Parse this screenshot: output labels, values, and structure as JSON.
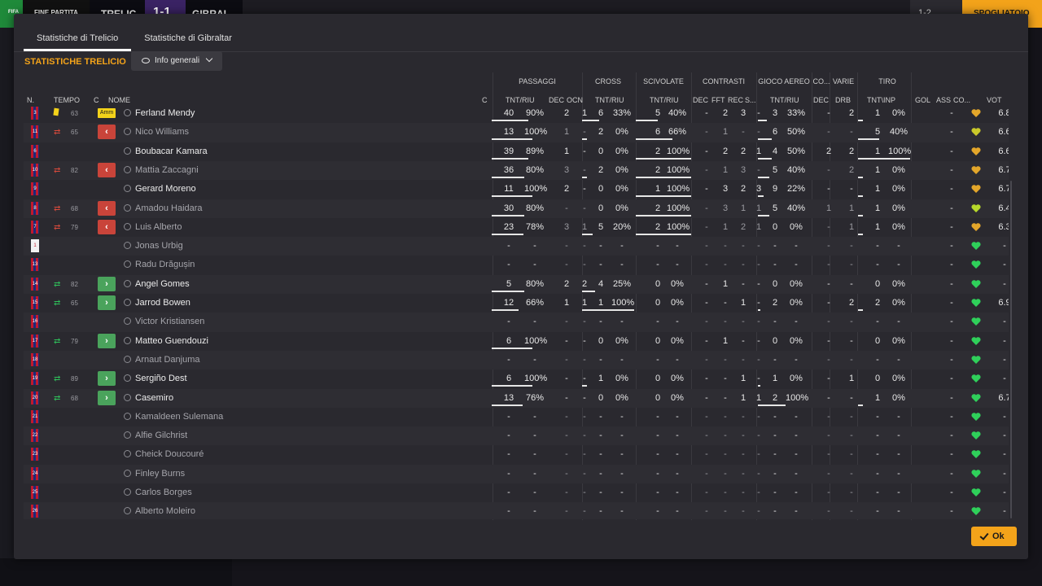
{
  "topbar": {
    "badge": "FIFA",
    "status": "FINE PARTITA",
    "home": "TRELIC",
    "score": "1-1",
    "away": "GIBRAL",
    "btn1": "1-2",
    "btn2": "⌄",
    "orange": "SPOGLIATOIO"
  },
  "tabs": [
    "Statistiche di Trelicio",
    "Statistiche di Gibraltar"
  ],
  "heading": "STATISTICHE TRELICIO",
  "dropdown": "Info generali",
  "group_headers": {
    "passaggi": "PASSAGGI",
    "cross": "CROSS",
    "scivolate": "SCIVOLATE",
    "contrasti": "CONTRASTI",
    "aereo": "GIOCO AEREO",
    "co": "CO...",
    "varie": "VARIE",
    "tiro": "TIRO"
  },
  "columns": {
    "n": "N.",
    "tempo": "TEMPO",
    "c": "C",
    "nome": "NOME",
    "c2": "C",
    "pass_tnt": "TNT/RIU",
    "pass_dec": "DEC",
    "pass_ocn": "OCN",
    "cross_tnt": "TNT/RIU",
    "sciv_tnt": "TNT/RIU",
    "con_dec": "DEC",
    "con_fft": "FFT",
    "con_rec": "REC",
    "con_s": "S...",
    "aer_tnt": "TNT/RIU",
    "co_dec": "DEC",
    "varie_drb": "DRB",
    "tiro_tnt": "TNT\\INP",
    "gol": "GOL",
    "ass": "ASS",
    "co2": "CO...",
    "vot": "VOT"
  },
  "players": [
    {
      "n": "3",
      "sub": "y",
      "min": "63",
      "c": "Amm",
      "name": "Ferland Mendy",
      "dim": false,
      "p1": "40",
      "p2": "90%",
      "p3": "2",
      "p4": "1",
      "c1": "6",
      "c2": "33%",
      "s1": "5",
      "s2": "40%",
      "k1": "-",
      "k2": "2",
      "k3": "3",
      "k4": "-",
      "a1": "3",
      "a2": "33%",
      "d1": "-",
      "d2": "2",
      "t1": "1",
      "t2": "0%",
      "g": "",
      "as": "-",
      "h": "#e3a62a",
      "v": "6.8"
    },
    {
      "n": "11",
      "sub": "o",
      "min": "65",
      "c": "o",
      "name": "Nico Williams",
      "dim": true,
      "p1": "13",
      "p2": "100%",
      "p3": "1",
      "p4": "-",
      "c1": "2",
      "c2": "0%",
      "s1": "6",
      "s2": "66%",
      "k1": "-",
      "k2": "1",
      "k3": "-",
      "k4": "-",
      "a1": "6",
      "a2": "50%",
      "d1": "-",
      "d2": "-",
      "t1": "5",
      "t2": "40%",
      "g": "",
      "as": "-",
      "h": "#c9c82a",
      "v": "6.6"
    },
    {
      "n": "6",
      "sub": "",
      "min": "",
      "c": "",
      "name": "Boubacar Kamara",
      "dim": false,
      "p1": "39",
      "p2": "89%",
      "p3": "1",
      "p4": "-",
      "c1": "0",
      "c2": "0%",
      "s1": "2",
      "s2": "100%",
      "k1": "-",
      "k2": "2",
      "k3": "2",
      "k4": "1",
      "a1": "4",
      "a2": "50%",
      "d1": "2",
      "d2": "2",
      "t1": "1",
      "t2": "100%",
      "g": "",
      "as": "-",
      "h": "#e3a62a",
      "v": "6.6"
    },
    {
      "n": "10",
      "sub": "o",
      "min": "82",
      "c": "o",
      "name": "Mattia Zaccagni",
      "dim": true,
      "p1": "36",
      "p2": "80%",
      "p3": "3",
      "p4": "-",
      "c1": "2",
      "c2": "0%",
      "s1": "2",
      "s2": "100%",
      "k1": "-",
      "k2": "1",
      "k3": "3",
      "k4": "-",
      "a1": "5",
      "a2": "40%",
      "d1": "-",
      "d2": "2",
      "t1": "1",
      "t2": "0%",
      "g": "",
      "as": "-",
      "h": "#e3a62a",
      "v": "6.7"
    },
    {
      "n": "9",
      "sub": "",
      "min": "",
      "c": "",
      "name": "Gerard Moreno",
      "dim": false,
      "p1": "11",
      "p2": "100%",
      "p3": "2",
      "p4": "-",
      "c1": "0",
      "c2": "0%",
      "s1": "1",
      "s2": "100%",
      "k1": "-",
      "k2": "3",
      "k3": "2",
      "k4": "3",
      "a1": "9",
      "a2": "22%",
      "d1": "-",
      "d2": "-",
      "t1": "1",
      "t2": "0%",
      "g": "",
      "as": "-",
      "h": "#e3a62a",
      "v": "6.7"
    },
    {
      "n": "8",
      "sub": "o",
      "min": "68",
      "c": "o",
      "name": "Amadou Haidara",
      "dim": true,
      "p1": "30",
      "p2": "80%",
      "p3": "-",
      "p4": "-",
      "c1": "0",
      "c2": "0%",
      "s1": "2",
      "s2": "100%",
      "k1": "-",
      "k2": "3",
      "k3": "1",
      "k4": "1",
      "a1": "5",
      "a2": "40%",
      "d1": "1",
      "d2": "1",
      "t1": "1",
      "t2": "0%",
      "g": "",
      "as": "-",
      "h": "#b6d82a",
      "v": "6.4"
    },
    {
      "n": "7",
      "sub": "o",
      "min": "79",
      "c": "o",
      "name": "Luis Alberto",
      "dim": true,
      "p1": "23",
      "p2": "78%",
      "p3": "3",
      "p4": "1",
      "c1": "5",
      "c2": "20%",
      "s1": "2",
      "s2": "100%",
      "k1": "-",
      "k2": "1",
      "k3": "2",
      "k4": "1",
      "a1": "0",
      "a2": "0%",
      "d1": "-",
      "d2": "1",
      "t1": "1",
      "t2": "0%",
      "g": "",
      "as": "-",
      "h": "#e3a62a",
      "v": "6.3"
    },
    {
      "n": "1",
      "sub": "",
      "min": "",
      "c": "",
      "name": "Jonas Urbig",
      "dim": true,
      "gk": true,
      "p1": "-",
      "p2": "-",
      "p3": "-",
      "p4": "-",
      "c1": "-",
      "c2": "-",
      "s1": "-",
      "s2": "-",
      "k1": "-",
      "k2": "-",
      "k3": "-",
      "k4": "-",
      "a1": "-",
      "a2": "-",
      "d1": "-",
      "d2": "-",
      "t1": "-",
      "t2": "-",
      "g": "",
      "as": "-",
      "h": "#2fd05a",
      "v": "-"
    },
    {
      "n": "13",
      "sub": "",
      "min": "",
      "c": "",
      "name": "Radu Drăgușin",
      "dim": true,
      "p1": "-",
      "p2": "-",
      "p3": "-",
      "p4": "-",
      "c1": "-",
      "c2": "-",
      "s1": "-",
      "s2": "-",
      "k1": "-",
      "k2": "-",
      "k3": "-",
      "k4": "-",
      "a1": "-",
      "a2": "-",
      "d1": "-",
      "d2": "-",
      "t1": "-",
      "t2": "-",
      "g": "",
      "as": "-",
      "h": "#2fd05a",
      "v": "-"
    },
    {
      "n": "14",
      "sub": "i",
      "min": "82",
      "c": "i",
      "name": "Angel Gomes",
      "dim": false,
      "p1": "5",
      "p2": "80%",
      "p3": "2",
      "p4": "2",
      "c1": "4",
      "c2": "25%",
      "s1": "0",
      "s2": "0%",
      "k1": "-",
      "k2": "1",
      "k3": "-",
      "k4": "-",
      "a1": "0",
      "a2": "0%",
      "d1": "-",
      "d2": "-",
      "t1": "0",
      "t2": "0%",
      "g": "",
      "as": "-",
      "h": "#2fd05a",
      "v": "-"
    },
    {
      "n": "15",
      "sub": "i",
      "min": "65",
      "c": "i",
      "name": "Jarrod Bowen",
      "dim": false,
      "p1": "12",
      "p2": "66%",
      "p3": "1",
      "p4": "1",
      "c1": "1",
      "c2": "100%",
      "s1": "0",
      "s2": "0%",
      "k1": "-",
      "k2": "-",
      "k3": "1",
      "k4": "-",
      "a1": "2",
      "a2": "0%",
      "d1": "-",
      "d2": "2",
      "t1": "2",
      "t2": "0%",
      "g": "",
      "as": "-",
      "h": "#2fd05a",
      "v": "6.9"
    },
    {
      "n": "16",
      "sub": "",
      "min": "",
      "c": "",
      "name": "Victor Kristiansen",
      "dim": true,
      "p1": "-",
      "p2": "-",
      "p3": "-",
      "p4": "-",
      "c1": "-",
      "c2": "-",
      "s1": "-",
      "s2": "-",
      "k1": "-",
      "k2": "-",
      "k3": "-",
      "k4": "-",
      "a1": "-",
      "a2": "-",
      "d1": "-",
      "d2": "-",
      "t1": "-",
      "t2": "-",
      "g": "",
      "as": "-",
      "h": "#2fd05a",
      "v": "-"
    },
    {
      "n": "17",
      "sub": "i",
      "min": "79",
      "c": "i",
      "name": "Matteo Guendouzi",
      "dim": false,
      "p1": "6",
      "p2": "100%",
      "p3": "-",
      "p4": "-",
      "c1": "0",
      "c2": "0%",
      "s1": "0",
      "s2": "0%",
      "k1": "-",
      "k2": "1",
      "k3": "-",
      "k4": "-",
      "a1": "0",
      "a2": "0%",
      "d1": "-",
      "d2": "-",
      "t1": "0",
      "t2": "0%",
      "g": "",
      "as": "-",
      "h": "#2fd05a",
      "v": "-"
    },
    {
      "n": "18",
      "sub": "",
      "min": "",
      "c": "",
      "name": "Arnaut Danjuma",
      "dim": true,
      "p1": "-",
      "p2": "-",
      "p3": "-",
      "p4": "-",
      "c1": "-",
      "c2": "-",
      "s1": "-",
      "s2": "-",
      "k1": "-",
      "k2": "-",
      "k3": "-",
      "k4": "-",
      "a1": "-",
      "a2": "-",
      "d1": "-",
      "d2": "-",
      "t1": "-",
      "t2": "-",
      "g": "",
      "as": "-",
      "h": "#2fd05a",
      "v": "-"
    },
    {
      "n": "19",
      "sub": "i",
      "min": "89",
      "c": "i",
      "name": "Sergiño Dest",
      "dim": false,
      "p1": "6",
      "p2": "100%",
      "p3": "-",
      "p4": "-",
      "c1": "1",
      "c2": "0%",
      "s1": "0",
      "s2": "0%",
      "k1": "-",
      "k2": "-",
      "k3": "1",
      "k4": "-",
      "a1": "1",
      "a2": "0%",
      "d1": "-",
      "d2": "1",
      "t1": "0",
      "t2": "0%",
      "g": "",
      "as": "-",
      "h": "#2fd05a",
      "v": "-"
    },
    {
      "n": "20",
      "sub": "i",
      "min": "68",
      "c": "i",
      "name": "Casemiro",
      "dim": false,
      "p1": "13",
      "p2": "76%",
      "p3": "-",
      "p4": "-",
      "c1": "0",
      "c2": "0%",
      "s1": "0",
      "s2": "0%",
      "k1": "-",
      "k2": "-",
      "k3": "1",
      "k4": "1",
      "a1": "2",
      "a2": "100%",
      "d1": "-",
      "d2": "-",
      "t1": "1",
      "t2": "0%",
      "g": "",
      "as": "-",
      "h": "#2fd05a",
      "v": "6.7"
    },
    {
      "n": "21",
      "sub": "",
      "min": "",
      "c": "",
      "name": "Kamaldeen Sulemana",
      "dim": true,
      "p1": "-",
      "p2": "-",
      "p3": "-",
      "p4": "-",
      "c1": "-",
      "c2": "-",
      "s1": "-",
      "s2": "-",
      "k1": "-",
      "k2": "-",
      "k3": "-",
      "k4": "-",
      "a1": "-",
      "a2": "-",
      "d1": "-",
      "d2": "-",
      "t1": "-",
      "t2": "-",
      "g": "",
      "as": "-",
      "h": "#2fd05a",
      "v": "-"
    },
    {
      "n": "22",
      "sub": "",
      "min": "",
      "c": "",
      "name": "Alfie Gilchrist",
      "dim": true,
      "p1": "-",
      "p2": "-",
      "p3": "-",
      "p4": "-",
      "c1": "-",
      "c2": "-",
      "s1": "-",
      "s2": "-",
      "k1": "-",
      "k2": "-",
      "k3": "-",
      "k4": "-",
      "a1": "-",
      "a2": "-",
      "d1": "-",
      "d2": "-",
      "t1": "-",
      "t2": "-",
      "g": "",
      "as": "-",
      "h": "#2fd05a",
      "v": "-"
    },
    {
      "n": "23",
      "sub": "",
      "min": "",
      "c": "",
      "name": "Cheick Doucouré",
      "dim": true,
      "p1": "-",
      "p2": "-",
      "p3": "-",
      "p4": "-",
      "c1": "-",
      "c2": "-",
      "s1": "-",
      "s2": "-",
      "k1": "-",
      "k2": "-",
      "k3": "-",
      "k4": "-",
      "a1": "-",
      "a2": "-",
      "d1": "-",
      "d2": "-",
      "t1": "-",
      "t2": "-",
      "g": "",
      "as": "-",
      "h": "#2fd05a",
      "v": "-"
    },
    {
      "n": "24",
      "sub": "",
      "min": "",
      "c": "",
      "name": "Finley Burns",
      "dim": true,
      "p1": "-",
      "p2": "-",
      "p3": "-",
      "p4": "-",
      "c1": "-",
      "c2": "-",
      "s1": "-",
      "s2": "-",
      "k1": "-",
      "k2": "-",
      "k3": "-",
      "k4": "-",
      "a1": "-",
      "a2": "-",
      "d1": "-",
      "d2": "-",
      "t1": "-",
      "t2": "-",
      "g": "",
      "as": "-",
      "h": "#2fd05a",
      "v": "-"
    },
    {
      "n": "25",
      "sub": "",
      "min": "",
      "c": "",
      "name": "Carlos Borges",
      "dim": true,
      "p1": "-",
      "p2": "-",
      "p3": "-",
      "p4": "-",
      "c1": "-",
      "c2": "-",
      "s1": "-",
      "s2": "-",
      "k1": "-",
      "k2": "-",
      "k3": "-",
      "k4": "-",
      "a1": "-",
      "a2": "-",
      "d1": "-",
      "d2": "-",
      "t1": "-",
      "t2": "-",
      "g": "",
      "as": "-",
      "h": "#2fd05a",
      "v": "-"
    },
    {
      "n": "26",
      "sub": "",
      "min": "",
      "c": "",
      "name": "Alberto Moleiro",
      "dim": true,
      "p1": "-",
      "p2": "-",
      "p3": "-",
      "p4": "-",
      "c1": "-",
      "c2": "-",
      "s1": "-",
      "s2": "-",
      "k1": "-",
      "k2": "-",
      "k3": "-",
      "k4": "-",
      "a1": "-",
      "a2": "-",
      "d1": "-",
      "d2": "-",
      "t1": "-",
      "t2": "-",
      "g": "",
      "as": "-",
      "h": "#2fd05a",
      "v": "-"
    }
  ],
  "ok_label": "Ok"
}
